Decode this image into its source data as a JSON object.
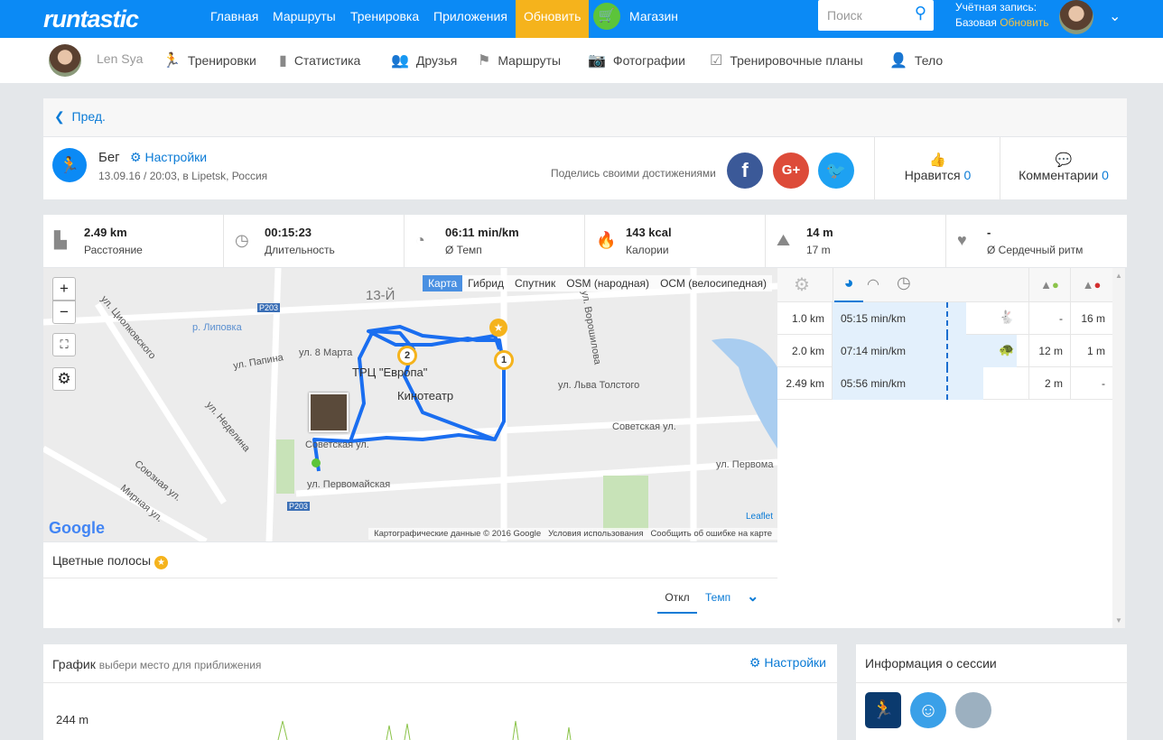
{
  "topbar": {
    "logo": "runtastic",
    "nav": [
      "Главная",
      "Маршруты",
      "Тренировка",
      "Приложения"
    ],
    "upgrade": "Обновить",
    "shop": "Магазин",
    "search_placeholder": "Поиск",
    "account_label": "Учётная запись:",
    "account_type": "Базовая",
    "account_upgrade": "Обновить"
  },
  "subnav": {
    "user": "Len Sya",
    "items": [
      "Тренировки",
      "Статистика",
      "Друзья",
      "Маршруты",
      "Фотографии",
      "Тренировочные планы",
      "Тело"
    ]
  },
  "back": "Пред.",
  "activity": {
    "type": "Бег",
    "settings": "Настройки",
    "date": "13.09.16 / 20:03, в Lipetsk, Россия",
    "share": "Поделись своими достижениями",
    "likes_label": "Нравится",
    "likes": "0",
    "comments_label": "Комментарии",
    "comments": "0"
  },
  "stats": [
    {
      "value": "2.49 km",
      "label": "Расстояние"
    },
    {
      "value": "00:15:23",
      "label": "Длительность"
    },
    {
      "value": "06:11 min/km",
      "label": "Ø Темп"
    },
    {
      "value": "143 kcal",
      "label": "Калории"
    },
    {
      "value": "14 m",
      "label": "17 m"
    },
    {
      "value": "-",
      "label": "Ø Сердечный ритм"
    }
  ],
  "map": {
    "types": [
      "Карта",
      "Гибрид",
      "Спутник",
      "OSM (народная)",
      "ОСМ (велосипедная)"
    ],
    "labels": [
      "13-Й",
      "ул. Циолковского",
      "р. Липовка",
      "ул. 8 Марта",
      "ул. Папина",
      "ТРЦ \"Европа\"",
      "Кинотеатр",
      "ул. Неделина",
      "Советская ул.",
      "ул. Первомайская",
      "Советская ул.",
      "ул. Льва Толстого",
      "ул. Ворошилова",
      "ул. Первома",
      "Союзная ул.",
      "Мирная ул.",
      "P203",
      "P203"
    ],
    "attribution": "Картографические данные © 2016 Google",
    "terms": "Условия использования",
    "report": "Сообщить об ошибке на карте",
    "leaflet": "Leaflet",
    "google": "Google"
  },
  "splits": [
    {
      "dist": "1.0 km",
      "pace": "05:15 min/km",
      "pace_min": 5.25,
      "up": "-",
      "down": "16 m",
      "marker": "fastest"
    },
    {
      "dist": "2.0 km",
      "pace": "07:14 min/km",
      "pace_min": 7.23,
      "up": "12 m",
      "down": "1 m",
      "marker": "slowest"
    },
    {
      "dist": "2.49 km",
      "pace": "05:56 min/km",
      "pace_min": 5.93,
      "up": "2 m",
      "down": "-",
      "marker": ""
    }
  ],
  "colorbands": {
    "title": "Цветные полосы",
    "off": "Откл",
    "pace": "Темп"
  },
  "graph": {
    "title": "График",
    "hint": "выбери место для приближения",
    "settings": "Настройки",
    "y_label": "244 m"
  },
  "session": {
    "title": "Информация о сессии"
  }
}
